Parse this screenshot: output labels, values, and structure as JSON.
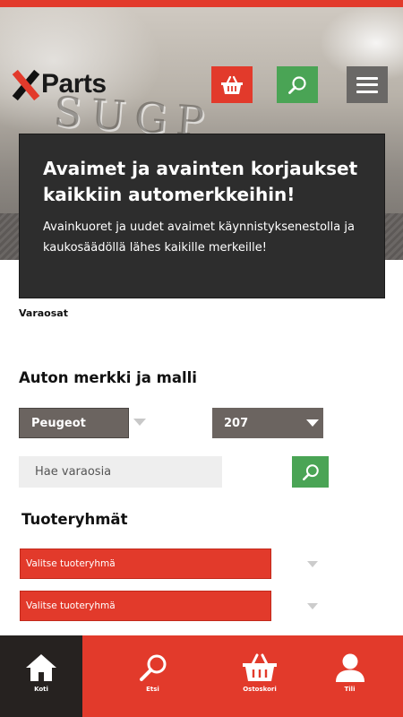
{
  "header": {
    "logo_text": "Parts",
    "logo_letter": "X",
    "hero_emblem": "SUGP",
    "icons": {
      "cart": "basket-icon",
      "search": "search-icon",
      "menu": "hamburger-menu-icon"
    }
  },
  "banner": {
    "title": "Avaimet ja avainten korjaukset kaikkiin automerkkeihin!",
    "text": "Avainkuoret ja uudet avaimet käynnistyksenestolla ja kaukosäädöllä lähes kaikille merkeille!"
  },
  "breadcrumb": "Varaosat",
  "vehicle": {
    "title": "Auton merkki ja malli",
    "brand": "Peugeot",
    "model": "207",
    "search_placeholder": "Hae varaosia"
  },
  "product_groups": {
    "title": "Tuoteryhmät",
    "select1": "Valitse tuoteryhmä",
    "select2": "Valitse tuoteryhmä"
  },
  "bottom_nav": [
    {
      "label": "Koti",
      "icon": "home-icon"
    },
    {
      "label": "Etsi",
      "icon": "search-icon"
    },
    {
      "label": "Ostoskori",
      "icon": "basket-icon"
    },
    {
      "label": "Tili",
      "icon": "user-icon"
    }
  ],
  "colors": {
    "accent_red": "#e23a2b",
    "accent_green": "#4aa455",
    "dark": "#2d2d2d"
  }
}
